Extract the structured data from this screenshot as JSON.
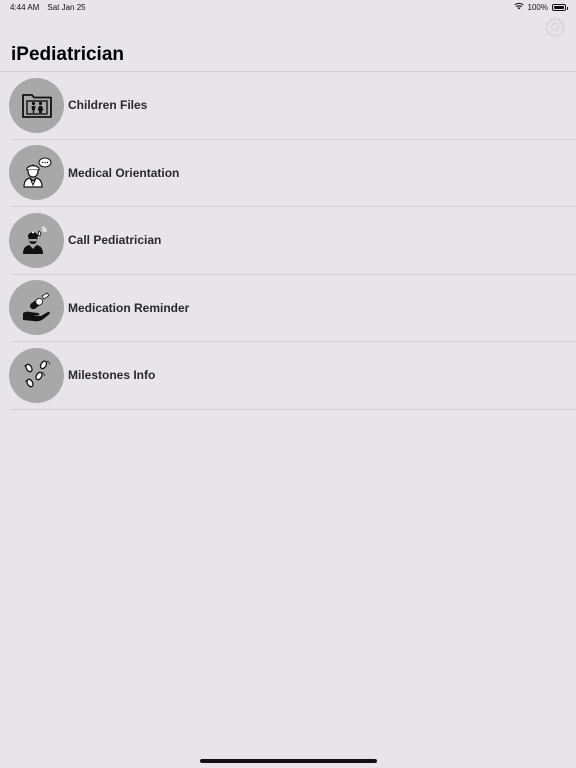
{
  "status_bar": {
    "time": "4:44 AM",
    "date": "Sat Jan 25",
    "battery_text": "100%",
    "battery_level": 1.0
  },
  "header": {
    "title": "iPediatrician",
    "settings_icon": "gear-icon"
  },
  "menu": {
    "items": [
      {
        "label": "Children Files",
        "icon": "children-folder-icon"
      },
      {
        "label": "Medical Orientation",
        "icon": "doctor-chat-icon"
      },
      {
        "label": "Call Pediatrician",
        "icon": "doctor-call-icon"
      },
      {
        "label": "Medication Reminder",
        "icon": "medication-hand-icon"
      },
      {
        "label": "Milestones Info",
        "icon": "footprints-icon"
      }
    ]
  },
  "colors": {
    "background": "#e7e5ea",
    "icon_circle": "#a8a8a8",
    "separator": "#d2d0d6"
  }
}
